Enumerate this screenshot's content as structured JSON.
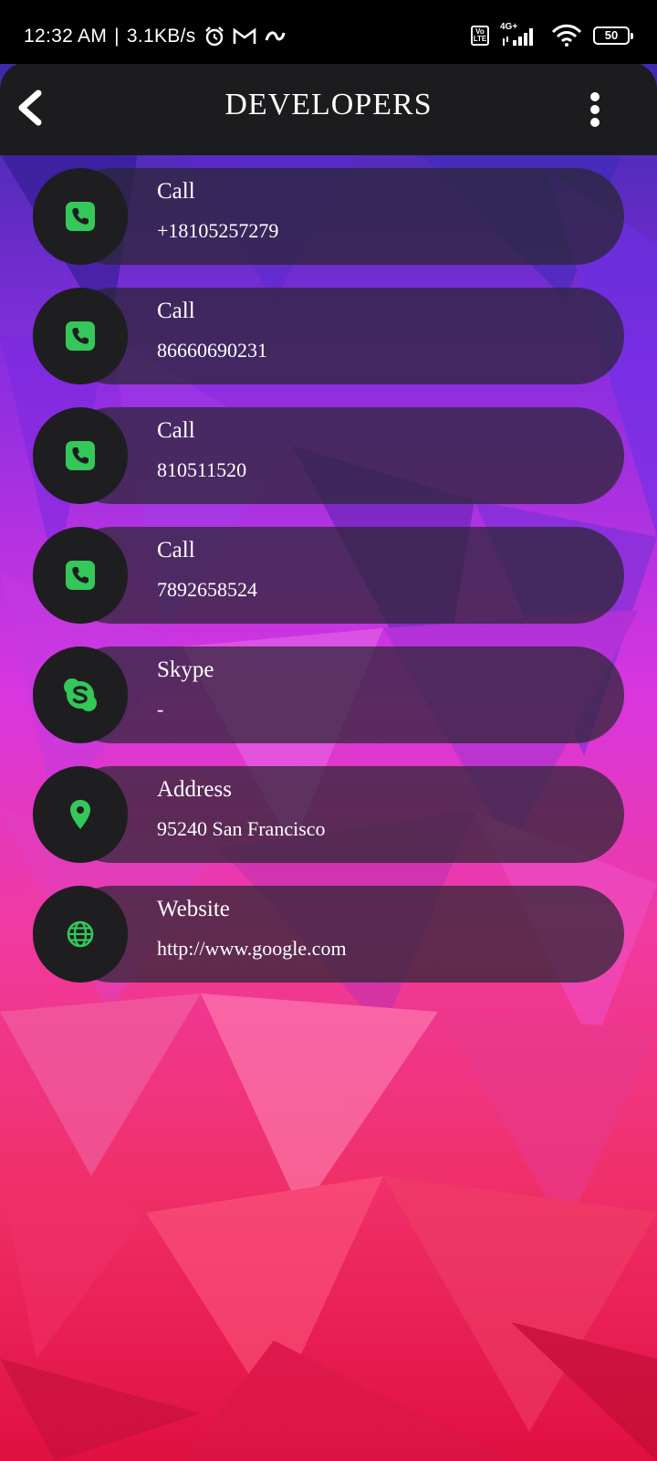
{
  "status_bar": {
    "time": "12:32 AM",
    "speed": "3.1KB/s",
    "network": "4G+",
    "battery": "50"
  },
  "app_bar": {
    "title": "DEVELOPERS"
  },
  "contacts": [
    {
      "label": "Call",
      "value": "+18105257279",
      "icon": "phone-icon"
    },
    {
      "label": "Call",
      "value": "86660690231",
      "icon": "phone-icon"
    },
    {
      "label": "Call",
      "value": "810511520",
      "icon": "phone-icon"
    },
    {
      "label": "Call",
      "value": "7892658524",
      "icon": "phone-icon"
    },
    {
      "label": "Skype",
      "value": "-",
      "icon": "skype-icon"
    },
    {
      "label": "Address",
      "value": "95240 San Francisco",
      "icon": "location-pin-icon"
    },
    {
      "label": "Website",
      "value": "http://www.google.com",
      "icon": "globe-icon"
    }
  ],
  "colors": {
    "accent_green": "#34c759",
    "app_bar": "#1c1c1e"
  }
}
